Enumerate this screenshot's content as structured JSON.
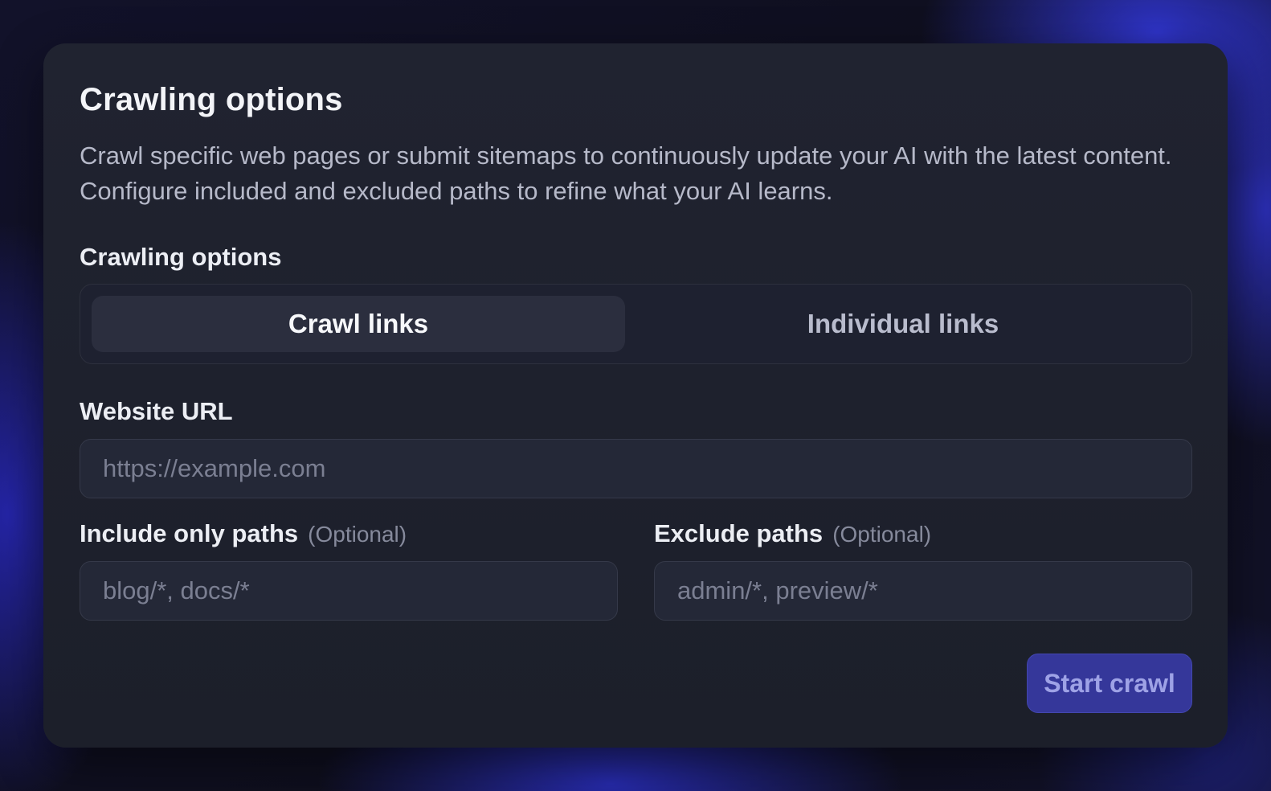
{
  "card": {
    "title": "Crawling options",
    "description": "Crawl specific web pages or submit sitemaps to continuously update your AI with the latest content. Configure included and excluded paths to refine what your AI learns."
  },
  "crawl_mode": {
    "label": "Crawling options",
    "options": [
      "Crawl links",
      "Individual links"
    ],
    "selected": "Crawl links"
  },
  "website_url": {
    "label": "Website URL",
    "value": "",
    "placeholder": "https://example.com"
  },
  "include_paths": {
    "label": "Include only paths",
    "optional_hint": "(Optional)",
    "value": "",
    "placeholder": "blog/*, docs/*"
  },
  "exclude_paths": {
    "label": "Exclude paths",
    "optional_hint": "(Optional)",
    "value": "",
    "placeholder": "admin/*, preview/*"
  },
  "actions": {
    "submit_label": "Start crawl"
  },
  "colors": {
    "card_background": "#1e212d",
    "accent_button": "#35379a",
    "accent_text": "#9ea2e6",
    "page_glow": "#3438e6"
  }
}
